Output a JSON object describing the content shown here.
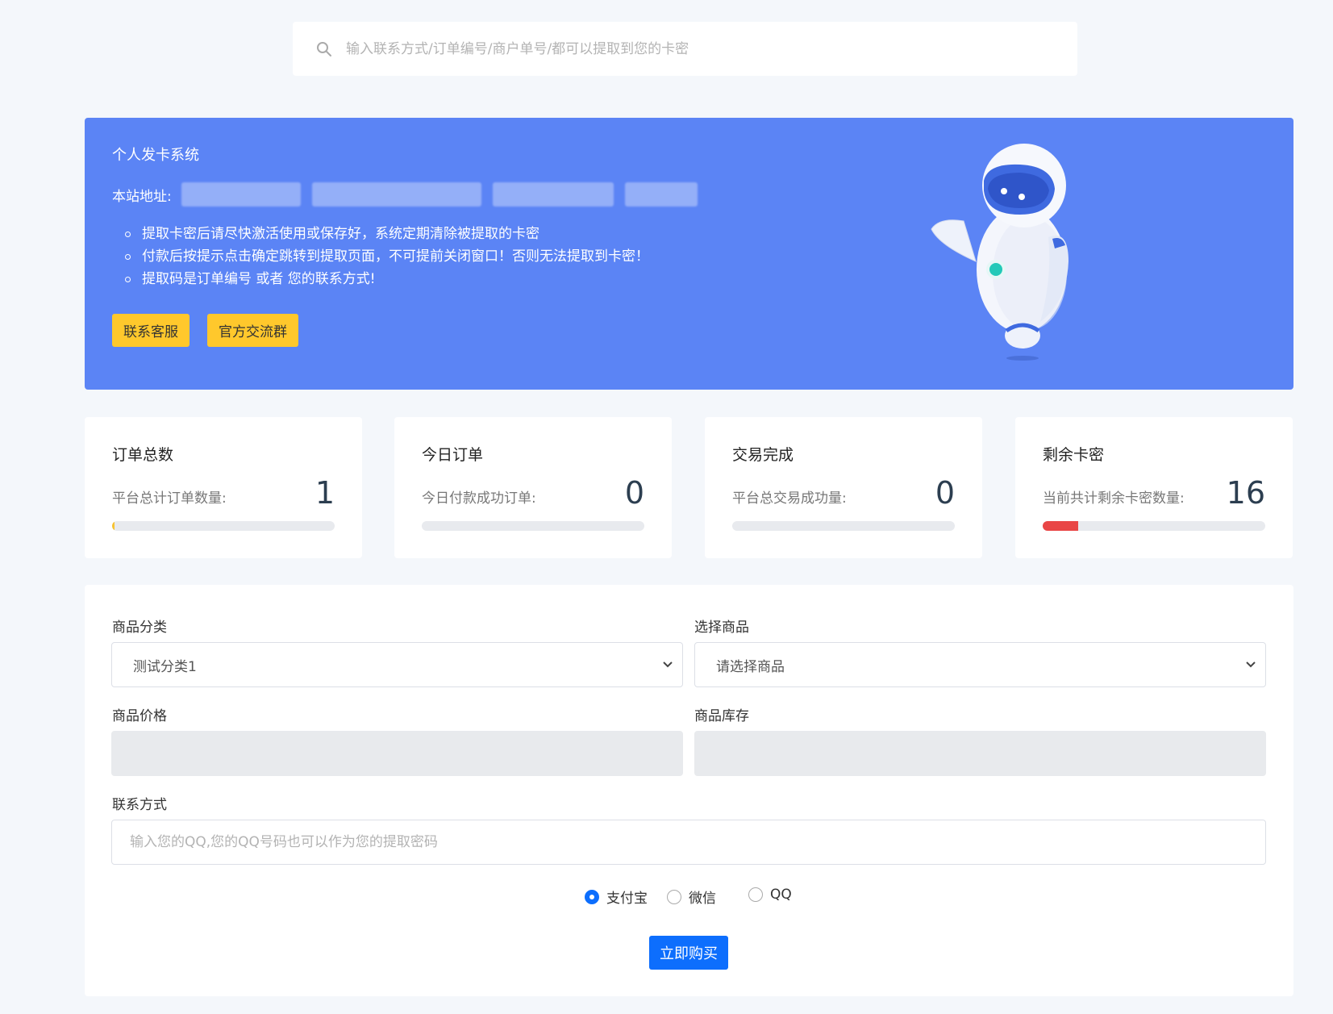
{
  "search": {
    "placeholder": "输入联系方式/订单编号/商户单号/都可以提取到您的卡密"
  },
  "banner": {
    "title": "个人发卡系统",
    "site_label": "本站地址:",
    "notes": [
      "提取卡密后请尽快激活使用或保存好，系统定期清除被提取的卡密",
      "付款后按提示点击确定跳转到提取页面，不可提前关闭窗口！否则无法提取到卡密！",
      "提取码是订单编号 或者 您的联系方式!"
    ],
    "buttons": [
      "联系客服",
      "官方交流群"
    ],
    "colors": {
      "background": "#5b84f5",
      "button": "#ffc82c"
    }
  },
  "stats": [
    {
      "title": "订单总数",
      "label": "平台总计订单数量:",
      "value": "1",
      "progress": 0.004,
      "bar_color": "#f7c331"
    },
    {
      "title": "今日订单",
      "label": "今日付款成功订单:",
      "value": "0",
      "progress": 0,
      "bar_color": "#5b84f5"
    },
    {
      "title": "交易完成",
      "label": "平台总交易成功量:",
      "value": "0",
      "progress": 0,
      "bar_color": "#28a745"
    },
    {
      "title": "剩余卡密",
      "label": "当前共计剩余卡密数量:",
      "value": "16",
      "progress": 0.16,
      "bar_color": "#e94646"
    }
  ],
  "form": {
    "category_label": "商品分类",
    "category_value": "测试分类1",
    "product_label": "选择商品",
    "product_value": "请选择商品",
    "price_label": "商品价格",
    "stock_label": "商品库存",
    "contact_label": "联系方式",
    "contact_placeholder": "输入您的QQ,您的QQ号码也可以作为您的提取密码",
    "payments": [
      "支付宝",
      "微信",
      "QQ"
    ],
    "payment_selected": "支付宝",
    "buy_label": "立即购买"
  }
}
